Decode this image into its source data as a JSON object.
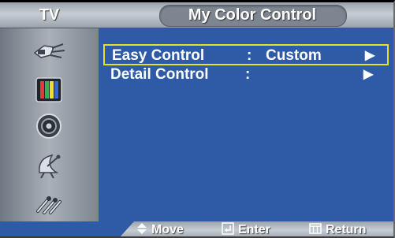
{
  "header": {
    "source_label": "TV",
    "title": "My Color Control"
  },
  "sidebar": {
    "icons": [
      "input-plug-icon",
      "color-bars-icon",
      "speaker-icon",
      "satellite-dish-icon",
      "setup-tools-icon"
    ],
    "active_index": 0
  },
  "menu": {
    "items": [
      {
        "label": "Easy Control",
        "separator": ":",
        "value": "Custom",
        "arrow": "▶"
      },
      {
        "label": "Detail Control",
        "separator": ":",
        "value": "",
        "arrow": "▶"
      }
    ],
    "selected_index": 0
  },
  "footer": {
    "move_label": "Move",
    "enter_label": "Enter",
    "return_label": "Return"
  },
  "colors": {
    "background": "#2f5aa5",
    "highlight": "#e9df2a",
    "bar": "#b0b7bf",
    "text": "#ffffff"
  }
}
